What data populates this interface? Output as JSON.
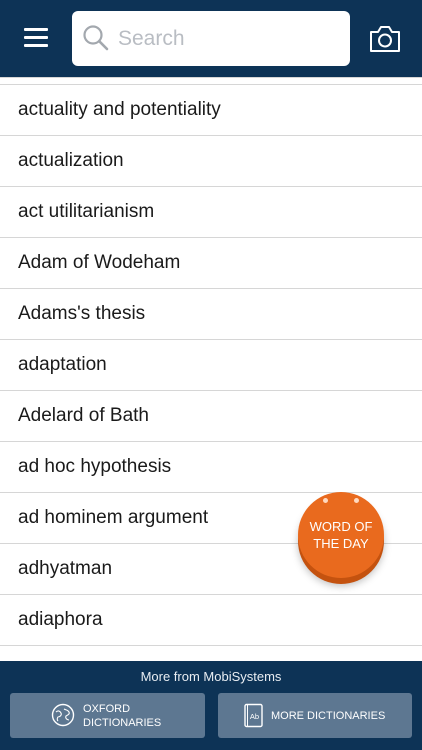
{
  "header": {
    "search_placeholder": "Search",
    "bg_color": "#0d3356"
  },
  "list": {
    "items": [
      {
        "label": "actuality and potentiality"
      },
      {
        "label": "actualization"
      },
      {
        "label": "act utilitarianism"
      },
      {
        "label": "Adam of Wodeham"
      },
      {
        "label": "Adams's thesis"
      },
      {
        "label": "adaptation"
      },
      {
        "label": "Adelard of Bath"
      },
      {
        "label": "ad hoc hypothesis"
      },
      {
        "label": "ad hominem argument"
      },
      {
        "label": "adhyatman"
      },
      {
        "label": "adiaphora"
      }
    ]
  },
  "word_of_the_day": {
    "line1": "WORD OF",
    "line2": "THE DAY",
    "color": "#e96a1e"
  },
  "footer": {
    "title": "More from MobiSystems",
    "oxford_line1": "OXFORD",
    "oxford_line2": "DICTIONARIES",
    "more_label": "MORE DICTIONARIES",
    "icon_text": "Ab",
    "button_color": "#5d7791"
  }
}
